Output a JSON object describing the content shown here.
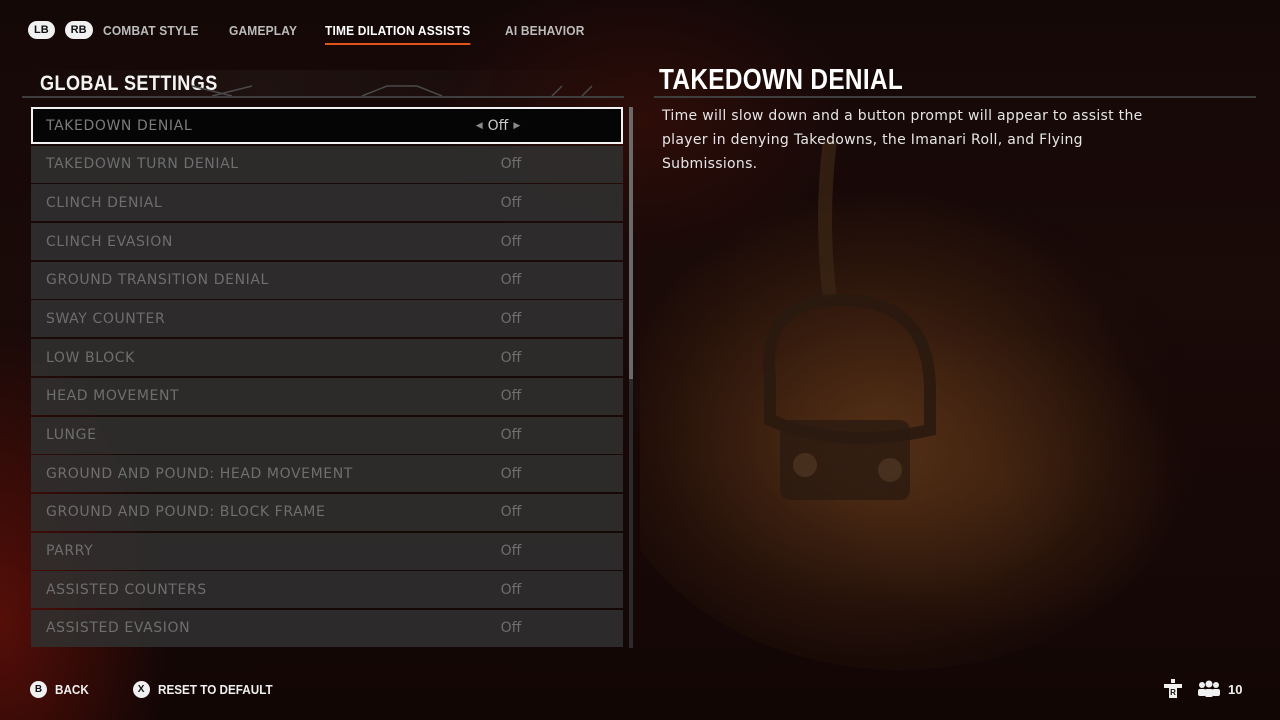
{
  "nav": {
    "lb": "LB",
    "rb": "RB",
    "tabs": [
      {
        "label": "COMBAT STYLE",
        "active": false
      },
      {
        "label": "GAMEPLAY",
        "active": false
      },
      {
        "label": "TIME DILATION ASSISTS",
        "active": true
      },
      {
        "label": "AI BEHAVIOR",
        "active": false
      }
    ],
    "accent": "#e3541c"
  },
  "settings": {
    "section_title": "GLOBAL SETTINGS",
    "rows": [
      {
        "label": "TAKEDOWN DENIAL",
        "value": "Off",
        "selected": true
      },
      {
        "label": "TAKEDOWN TURN DENIAL",
        "value": "Off"
      },
      {
        "label": "CLINCH DENIAL",
        "value": "Off"
      },
      {
        "label": "CLINCH EVASION",
        "value": "Off"
      },
      {
        "label": "GROUND TRANSITION DENIAL",
        "value": "Off"
      },
      {
        "label": "SWAY COUNTER",
        "value": "Off"
      },
      {
        "label": "LOW BLOCK",
        "value": "Off"
      },
      {
        "label": "HEAD MOVEMENT",
        "value": "Off"
      },
      {
        "label": "LUNGE",
        "value": "Off"
      },
      {
        "label": "GROUND AND POUND: HEAD MOVEMENT",
        "value": "Off"
      },
      {
        "label": "GROUND AND POUND: BLOCK FRAME",
        "value": "Off"
      },
      {
        "label": "PARRY",
        "value": "Off"
      },
      {
        "label": "ASSISTED COUNTERS",
        "value": "Off"
      },
      {
        "label": "ASSISTED EVASION",
        "value": "Off"
      }
    ]
  },
  "detail": {
    "title": "TAKEDOWN DENIAL",
    "line1": "Time will slow down and a button prompt will appear to assist the",
    "line2": "player in denying Takedowns, the Imanari Roll, and Flying Submissions."
  },
  "footer": {
    "back_key": "B",
    "back_label": "BACK",
    "reset_key": "X",
    "reset_label": "RESET TO DEFAULT"
  },
  "status": {
    "icon": "party-icon",
    "count": "10"
  }
}
